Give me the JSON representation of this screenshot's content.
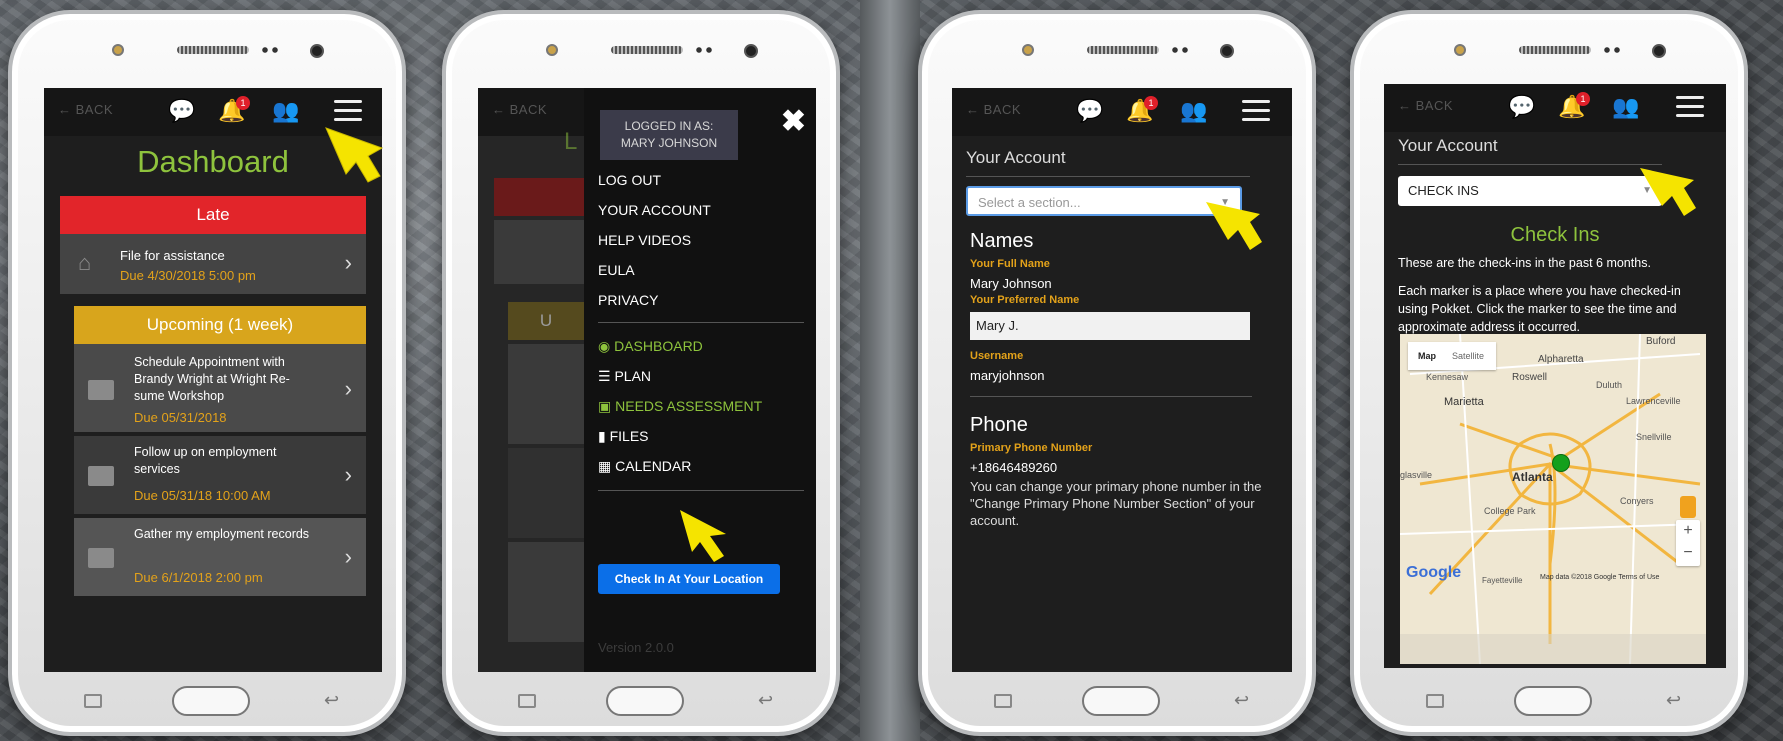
{
  "common": {
    "back": "BACK",
    "bell_badge": "1"
  },
  "dashboard": {
    "title": "Dashboard",
    "late_header": "Late",
    "late_item": {
      "title": "File for assistance",
      "due": "Due 4/30/2018 5:00 pm"
    },
    "upcoming_header": "Upcoming (1 week)",
    "upcoming_items": [
      {
        "title": "Schedule Appointment with Brandy Wright at Wright Re-sume Workshop",
        "due": "Due 05/31/2018"
      },
      {
        "title": "Follow up on employment services",
        "due": "Due 05/31/18 10:00 AM"
      },
      {
        "title": "Gather my employment records",
        "due": "Due 6/1/2018 2:00 pm"
      }
    ]
  },
  "menu": {
    "logged_in_as": "LOGGED IN AS:",
    "user_name": "MARY JOHNSON",
    "items": [
      "LOG OUT",
      "YOUR ACCOUNT",
      "HELP VIDEOS",
      "EULA",
      "PRIVACY"
    ],
    "nav": [
      {
        "label": "DASHBOARD",
        "icon": "dashboard-icon",
        "green": true
      },
      {
        "label": "PLAN",
        "icon": "list-icon",
        "green": false
      },
      {
        "label": "NEEDS ASSESSMENT",
        "icon": "briefcase-icon",
        "green": true
      },
      {
        "label": "FILES",
        "icon": "file-icon",
        "green": false
      },
      {
        "label": "CALENDAR",
        "icon": "calendar-icon",
        "green": false
      }
    ],
    "check_in": "Check In At Your Location",
    "version": "Version 2.0.0",
    "behind_title": "L",
    "behind_upcoming": "U"
  },
  "account": {
    "title": "Your Account",
    "select_placeholder": "Select a section...",
    "names_heading": "Names",
    "full_name_label": "Your Full Name",
    "full_name": "Mary Johnson",
    "preferred_label": "Your Preferred Name",
    "preferred_value": "Mary J.",
    "username_label": "Username",
    "username": "maryjohnson",
    "phone_heading": "Phone",
    "phone_label": "Primary Phone Number",
    "phone": "+18646489260",
    "phone_note": "You can change your primary phone number in the \"Change Primary Phone Number Section\" of your account."
  },
  "checkins": {
    "title": "Your Account",
    "select_value": "CHECK INS",
    "heading": "Check Ins",
    "p1": "These are the check-ins in the past 6 months.",
    "p2": "Each marker is a place where you have checked-in using Pokket. Click the marker to see the time and approximate address it occurred.",
    "map_tabs": [
      "Map",
      "Satellite"
    ],
    "map_labels": [
      "Buford",
      "Alpharetta",
      "Kennesaw",
      "Roswell",
      "Duluth",
      "Marietta",
      "Lawrenceville",
      "Snellville",
      "Atlanta",
      "glasville",
      "College Park",
      "Conyers",
      "Fayetteville"
    ],
    "google": "Google",
    "map_footer": "Map data ©2018 Google   Terms of Use"
  }
}
